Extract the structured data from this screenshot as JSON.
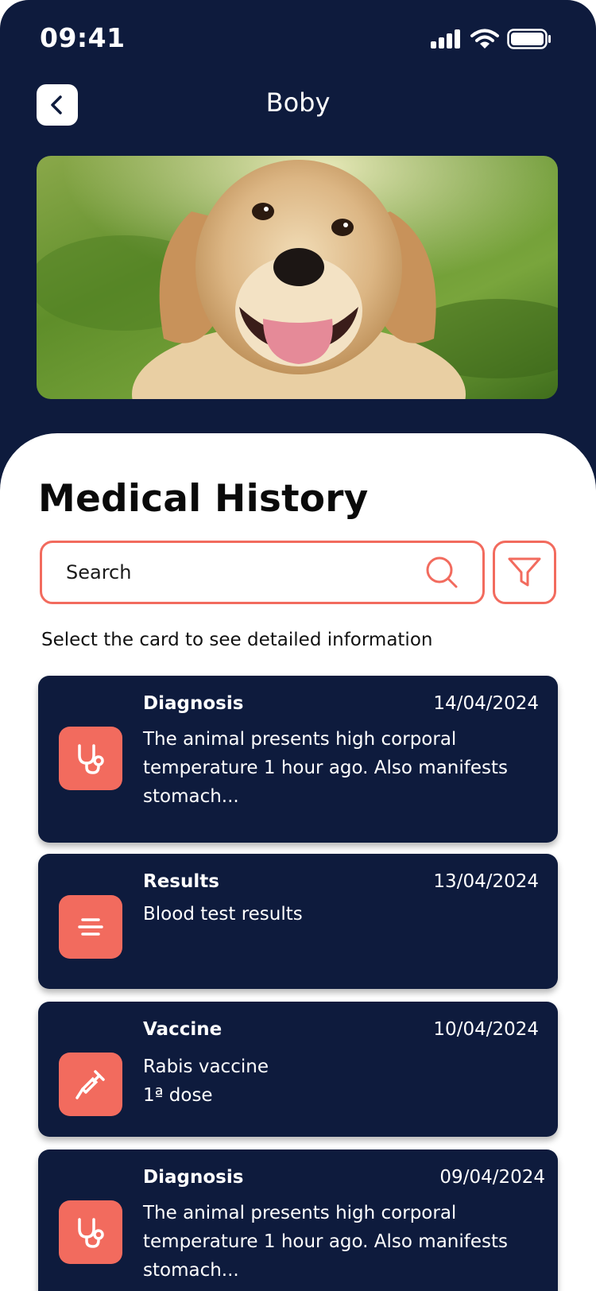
{
  "status": {
    "time": "09:41"
  },
  "header": {
    "title": "Boby"
  },
  "main": {
    "title": "Medical History",
    "search": {
      "placeholder": "Search",
      "value": ""
    },
    "hint": "Select the card to see detailed information"
  },
  "records": [
    {
      "type": "Diagnosis",
      "date": "14/04/2024",
      "description": "The animal presents high corporal temperature 1 hour ago. Also manifests stomach...",
      "icon": "stethoscope-icon"
    },
    {
      "type": "Results",
      "date": "13/04/2024",
      "description": "Blood test results",
      "icon": "lines-icon"
    },
    {
      "type": "Vaccine",
      "date": "10/04/2024",
      "description": "Rabis vaccine\n1ª dose",
      "icon": "syringe-icon"
    },
    {
      "type": "Diagnosis",
      "date": "09/04/2024",
      "description": "The animal presents high corporal temperature 1 hour ago. Also manifests stomach...",
      "icon": "stethoscope-icon"
    }
  ],
  "colors": {
    "navy": "#0e1b3d",
    "accent": "#f26b5e",
    "white": "#ffffff"
  }
}
